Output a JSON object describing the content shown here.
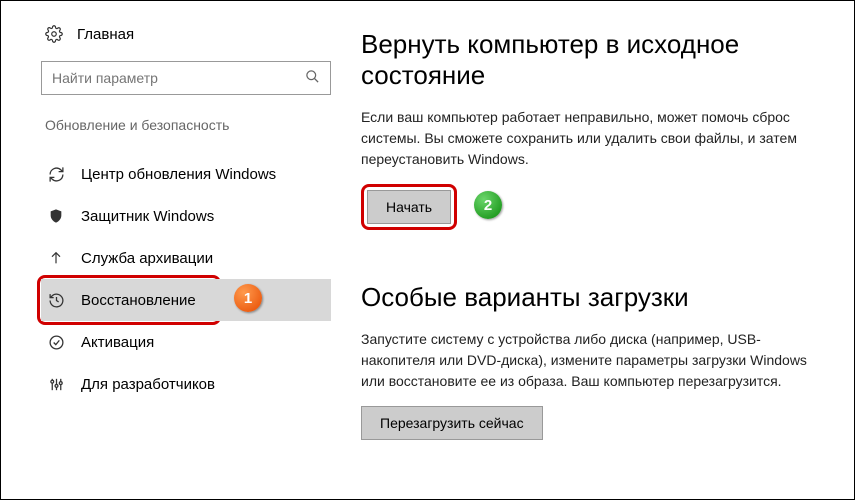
{
  "sidebar": {
    "home": "Главная",
    "search_placeholder": "Найти параметр",
    "section_title": "Обновление и безопасность",
    "items": [
      {
        "label": "Центр обновления Windows"
      },
      {
        "label": "Защитник Windows"
      },
      {
        "label": "Служба архивации"
      },
      {
        "label": "Восстановление"
      },
      {
        "label": "Активация"
      },
      {
        "label": "Для разработчиков"
      }
    ]
  },
  "main": {
    "reset": {
      "heading": "Вернуть компьютер в исходное состояние",
      "body": "Если ваш компьютер работает неправильно, может помочь сброс системы. Вы сможете сохранить или удалить свои файлы, и затем переустановить Windows.",
      "button": "Начать"
    },
    "advanced": {
      "heading": "Особые варианты загрузки",
      "body": "Запустите систему с устройства либо диска (например, USB-накопителя или DVD-диска), измените параметры загрузки Windows или восстановите ее из образа. Ваш компьютер перезагрузится.",
      "button": "Перезагрузить сейчас"
    }
  },
  "annotations": {
    "badge1": "1",
    "badge2": "2"
  }
}
